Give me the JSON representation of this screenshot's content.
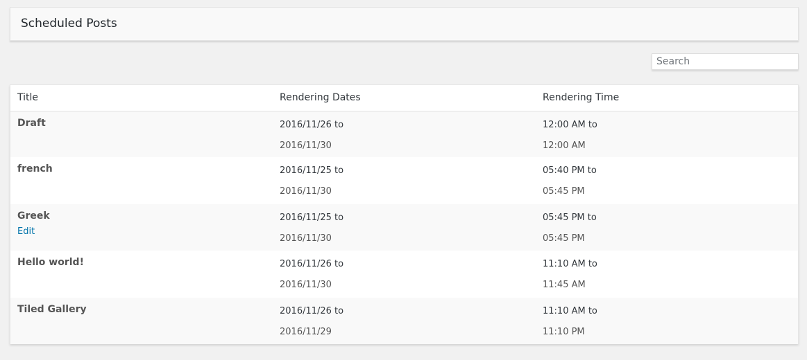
{
  "page": {
    "title": "Scheduled Posts"
  },
  "search": {
    "placeholder": "Search"
  },
  "table": {
    "columns": [
      "Title",
      "Rendering Dates",
      "Rendering Time"
    ],
    "rows": [
      {
        "title": "Draft",
        "edit": "",
        "date_start": "2016/11/26 to",
        "date_end": "2016/11/30",
        "time_start": "12:00 AM to",
        "time_end": "12:00 AM"
      },
      {
        "title": "french",
        "edit": "",
        "date_start": "2016/11/25 to",
        "date_end": "2016/11/30",
        "time_start": "05:40 PM to",
        "time_end": "05:45 PM"
      },
      {
        "title": "Greek",
        "edit": "Edit",
        "date_start": "2016/11/25 to",
        "date_end": "2016/11/30",
        "time_start": "05:45 PM to",
        "time_end": "05:45 PM"
      },
      {
        "title": "Hello world!",
        "edit": "",
        "date_start": "2016/11/26 to",
        "date_end": "2016/11/30",
        "time_start": "11:10 AM to",
        "time_end": "11:45 AM"
      },
      {
        "title": "Tiled Gallery",
        "edit": "",
        "date_start": "2016/11/26 to",
        "date_end": "2016/11/29",
        "time_start": "11:10 AM to",
        "time_end": "11:10 PM"
      }
    ]
  },
  "colors": {
    "background": "#f1f1f1",
    "link": "#0073aa",
    "stripe": "#f9f9f9"
  }
}
